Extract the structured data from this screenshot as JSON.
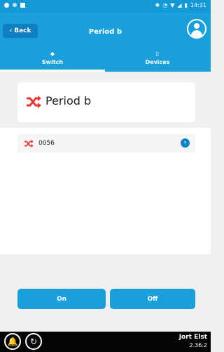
{
  "status_bar": {
    "time": "14:31"
  },
  "nav": {
    "back_label": "Back",
    "title": "Period b"
  },
  "tabs": [
    {
      "label": "Switch",
      "active": true
    },
    {
      "label": "Devices",
      "active": false
    }
  ],
  "header": {
    "title": "Period b"
  },
  "list": {
    "items": [
      {
        "name": "0056"
      }
    ]
  },
  "actions": {
    "on_label": "On",
    "off_label": "Off"
  },
  "footer": {
    "user": "Jort Elst",
    "version": "2.36.2"
  },
  "colors": {
    "primary": "#1a9fdb",
    "accent_red": "#e53935",
    "bottom_bar": "#050505"
  }
}
